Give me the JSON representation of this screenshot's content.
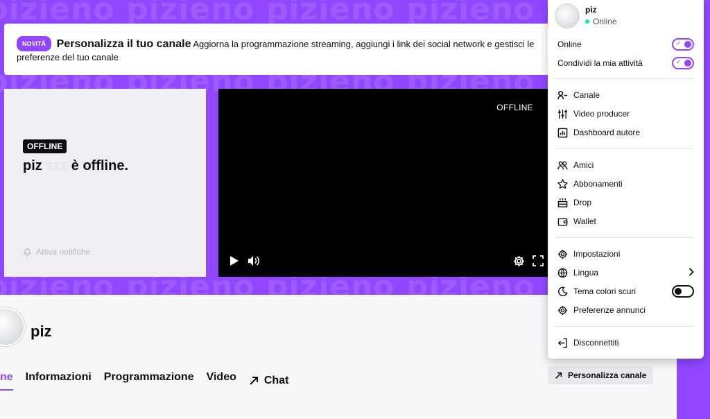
{
  "banner": {
    "watermark": "pizieno pizieno pizieno pizieno pizieno pizieno",
    "color": "#9147ff"
  },
  "notice": {
    "badge": "NOVITÀ",
    "title": "Personalizza il tuo canale",
    "text": "Aggiorna la programmazione streaming, aggiungi i link dei social network e gestisci le preferenze del tuo canale",
    "text_line1": "Aggiorna la programmazione streaming, aggiungi i link dei social network e gestisci le prefere",
    "text_line2": "del tuo canale"
  },
  "offline_panel": {
    "tag": "OFFLINE",
    "name": "piz",
    "status": "è offline.",
    "notify": "Attiva notifiche"
  },
  "player": {
    "status": "OFFLINE"
  },
  "channel": {
    "name": "piz",
    "tabs": [
      {
        "label": "ne",
        "active": true
      },
      {
        "label": "Informazioni",
        "active": false
      },
      {
        "label": "Programmazione",
        "active": false
      },
      {
        "label": "Video",
        "active": false
      },
      {
        "label": "Chat",
        "active": false
      }
    ],
    "customize_button": "Personalizza canale"
  },
  "menu": {
    "username": "piz",
    "status": "Online",
    "toggles": [
      {
        "label": "Online",
        "on": true
      },
      {
        "label": "Condividi la mia attività",
        "on": true
      }
    ],
    "group1": [
      "Canale",
      "Video producer",
      "Dashboard autore"
    ],
    "group2": [
      "Amici",
      "Abbonamenti",
      "Drop",
      "Wallet"
    ],
    "group3": [
      "Impostazioni",
      "Lingua",
      "Tema colori scuri",
      "Preferenze annunci"
    ],
    "dark_theme_on": false,
    "logout": "Disconnettiti"
  }
}
